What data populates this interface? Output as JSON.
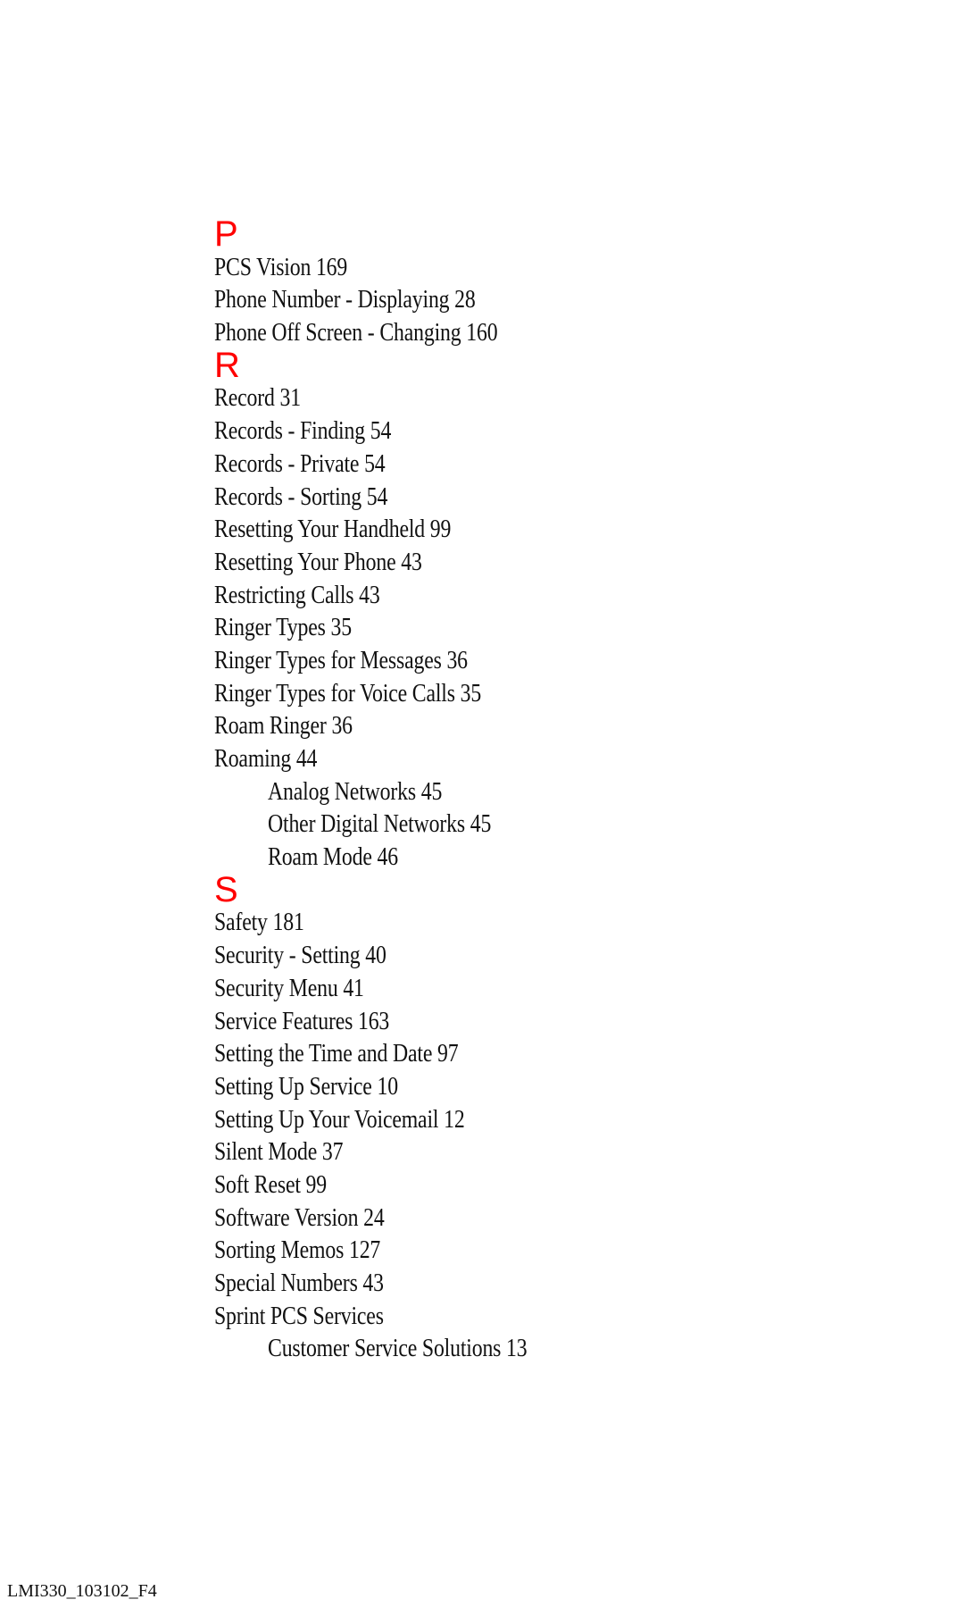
{
  "sections": [
    {
      "letter": "P",
      "entries": [
        {
          "text": "PCS Vision 169",
          "level": 0
        },
        {
          "text": "Phone Number - Displaying 28",
          "level": 0
        },
        {
          "text": "Phone Off Screen - Changing 160",
          "level": 0
        }
      ]
    },
    {
      "letter": "R",
      "entries": [
        {
          "text": "Record 31",
          "level": 0
        },
        {
          "text": "Records - Finding 54",
          "level": 0
        },
        {
          "text": "Records - Private 54",
          "level": 0
        },
        {
          "text": "Records - Sorting 54",
          "level": 0
        },
        {
          "text": "Resetting Your Handheld 99",
          "level": 0
        },
        {
          "text": "Resetting Your Phone 43",
          "level": 0
        },
        {
          "text": "Restricting Calls 43",
          "level": 0
        },
        {
          "text": "Ringer Types 35",
          "level": 0
        },
        {
          "text": "Ringer Types for Messages 36",
          "level": 0
        },
        {
          "text": "Ringer Types for Voice Calls 35",
          "level": 0
        },
        {
          "text": "Roam Ringer 36",
          "level": 0
        },
        {
          "text": "Roaming 44",
          "level": 0
        },
        {
          "text": "Analog Networks 45",
          "level": 1
        },
        {
          "text": "Other Digital Networks 45",
          "level": 1
        },
        {
          "text": "Roam Mode 46",
          "level": 1
        }
      ]
    },
    {
      "letter": "S",
      "entries": [
        {
          "text": "Safety 181",
          "level": 0
        },
        {
          "text": "Security - Setting 40",
          "level": 0
        },
        {
          "text": "Security Menu 41",
          "level": 0
        },
        {
          "text": "Service Features 163",
          "level": 0
        },
        {
          "text": "Setting the Time and Date 97",
          "level": 0
        },
        {
          "text": "Setting Up Service 10",
          "level": 0
        },
        {
          "text": "Setting Up Your Voicemail 12",
          "level": 0
        },
        {
          "text": "Silent Mode 37",
          "level": 0
        },
        {
          "text": "Soft Reset 99",
          "level": 0
        },
        {
          "text": "Software Version 24",
          "level": 0
        },
        {
          "text": "Sorting Memos 127",
          "level": 0
        },
        {
          "text": "Special Numbers 43",
          "level": 0
        },
        {
          "text": "Sprint PCS Services",
          "level": 0
        },
        {
          "text": "Customer Service Solutions 13",
          "level": 1
        }
      ]
    }
  ],
  "footer": "LMI330_103102_F4"
}
